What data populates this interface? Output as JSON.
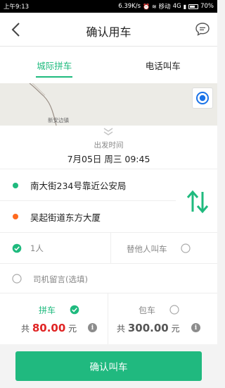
{
  "status_bar": {
    "time": "上午9:13",
    "network_speed": "6.39K/s",
    "carrier": "移动",
    "network_type": "4G",
    "battery": "70%",
    "battery_level": 0.7
  },
  "header": {
    "title": "确认用车",
    "back_icon": "chevron-left-icon",
    "message_icon": "chat-bubble-icon"
  },
  "tabs": [
    {
      "label": "城际拼车",
      "active": true
    },
    {
      "label": "电话叫车",
      "active": false
    }
  ],
  "map": {
    "place_label": "新安边镇",
    "locate_icon": "locate-target-icon"
  },
  "departure": {
    "label": "出发时间",
    "value": "7月05日 周三 09:45"
  },
  "addresses": {
    "from": "南大街234号靠近公安局",
    "to": "吴起街道东方大厦",
    "from_color": "#1fba7e",
    "to_color": "#ff6a1f",
    "swap_icon": "swap-vertical-icon"
  },
  "passengers": {
    "count_label": "1人",
    "count_checked": true,
    "other_label": "替他人叫车",
    "other_checked": false
  },
  "note": {
    "label": "司机留言(选填)",
    "checked": false
  },
  "pricing": {
    "carpool": {
      "label": "拼车",
      "checked": true,
      "prefix": "共",
      "amount": "80.00",
      "unit": "元"
    },
    "charter": {
      "label": "包车",
      "checked": false,
      "prefix": "共",
      "amount": "300.00",
      "unit": "元"
    },
    "info_glyph": "i"
  },
  "confirm_button": {
    "label": "确认叫车"
  },
  "colors": {
    "accent": "#1fba7e",
    "price_highlight": "#e02424",
    "button": "#20b97f"
  }
}
